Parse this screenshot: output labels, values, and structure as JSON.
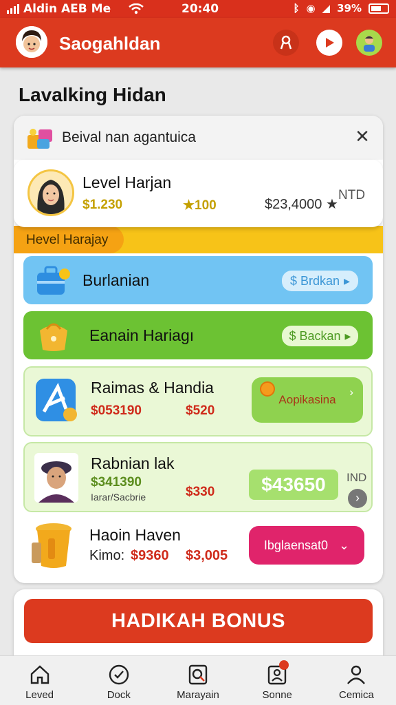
{
  "status_bar": {
    "carrier": "Aldin AEB Me",
    "time": "20:40",
    "battery": "39%"
  },
  "app_bar": {
    "title": "Saogahldan"
  },
  "page_title": "Lavalking Hidan",
  "card": {
    "header_text": "Beival nan agantuica"
  },
  "profile": {
    "name": "Level Harjan",
    "balance": "$1.230",
    "stars": "★100",
    "total": "$23,4000 ★",
    "currency": "NTD"
  },
  "ribbon": {
    "label": "Hevel Harajay"
  },
  "rows": [
    {
      "title": "Burlanian",
      "button": "$ Brdkan"
    },
    {
      "title": "Eanain Hariagı",
      "button": "$ Backan"
    },
    {
      "title": "Raimas & Handia",
      "amount_a": "$053190",
      "amount_b": "$520",
      "button": "Aopikasina"
    },
    {
      "title": "Rabnian lak",
      "amount_a": "$341390",
      "sublabel": "Iarar/Sacbrie",
      "amount_b": "$330",
      "button": "$43650",
      "currency": "IND"
    },
    {
      "title": "Haoin Haven",
      "prefix": "Kimo:",
      "amount_a": "$9360",
      "amount_b": "$3,005",
      "button": "Ibglaensat0"
    }
  ],
  "bonus": {
    "label": "HADIKAH BONUS"
  },
  "bottom_nav": [
    {
      "label": "Leved",
      "icon": "home-icon"
    },
    {
      "label": "Dock",
      "icon": "check-circle-icon"
    },
    {
      "label": "Marayain",
      "icon": "search-doc-icon"
    },
    {
      "label": "Sonne",
      "icon": "profile-card-icon"
    },
    {
      "label": "Cemica",
      "icon": "user-icon"
    }
  ],
  "colors": {
    "brand_red": "#dc3a1f",
    "ribbon_yellow": "#f7c318",
    "row_blue": "#71c4f3",
    "row_green": "#6cc233",
    "pink": "#e0246b"
  }
}
